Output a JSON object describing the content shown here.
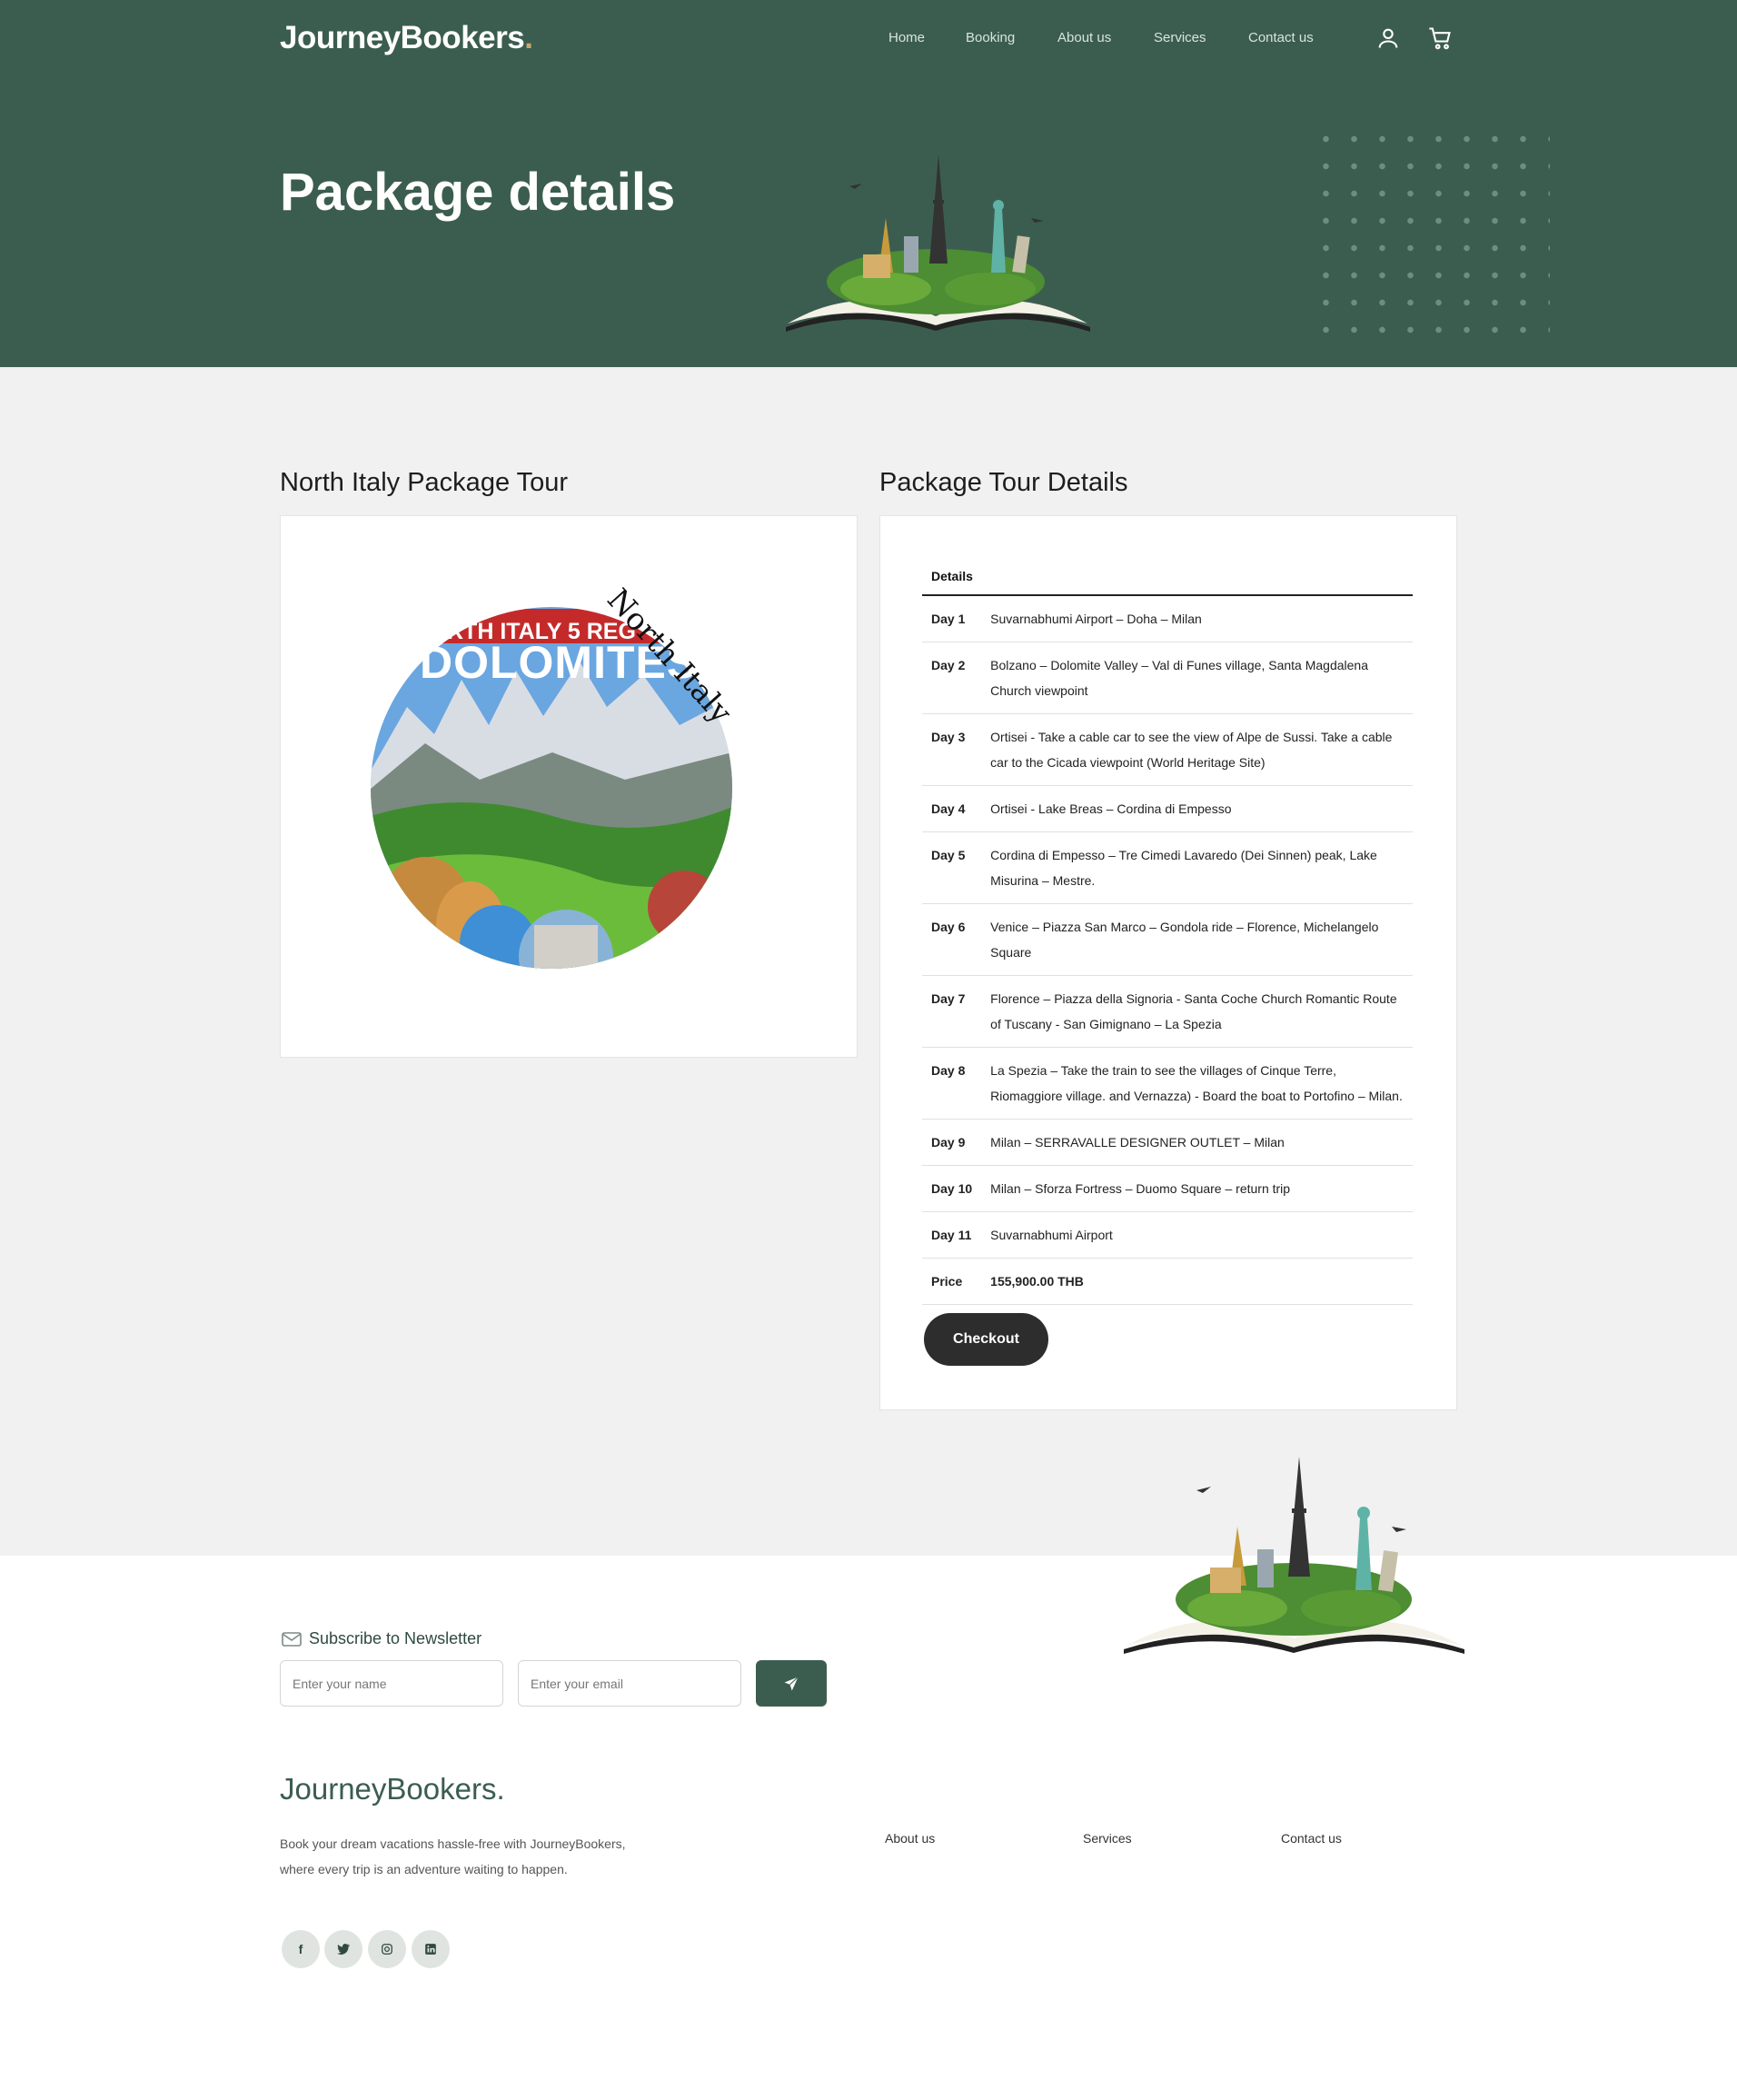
{
  "header": {
    "brand": "JourneyBookers",
    "brand_dot": ".",
    "nav": [
      "Home",
      "Booking",
      "About us",
      "Services",
      "Contact us"
    ],
    "icons": [
      "user-icon",
      "cart-icon"
    ]
  },
  "hero": {
    "title": "Package details"
  },
  "left": {
    "title": "North Italy Package Tour",
    "image_banner": "RTH ITALY 5 REG",
    "image_headline": "DOLOMITES",
    "image_script": "North Italy"
  },
  "right": {
    "title": "Package Tour Details",
    "table_header": "Details",
    "rows": [
      {
        "day": "Day 1",
        "text": "Suvarnabhumi Airport – Doha – Milan"
      },
      {
        "day": "Day 2",
        "text": "Bolzano – Dolomite Valley – Val di Funes village, Santa Magdalena Church viewpoint"
      },
      {
        "day": "Day 3",
        "text": "Ortisei - Take a cable car to see the view of Alpe de Sussi. Take a cable car to the Cicada viewpoint (World Heritage Site)"
      },
      {
        "day": "Day 4",
        "text": "Ortisei - Lake Breas – Cordina di Empesso"
      },
      {
        "day": "Day 5",
        "text": "Cordina di Empesso – Tre Cimedi Lavaredo (Dei Sinnen) peak, Lake Misurina – Mestre."
      },
      {
        "day": "Day 6",
        "text": "Venice – Piazza San Marco – Gondola ride – Florence, Michelangelo Square"
      },
      {
        "day": "Day 7",
        "text": "Florence – Piazza della Signoria - Santa Coche Church Romantic Route of Tuscany - San Gimignano – La Spezia"
      },
      {
        "day": "Day 8",
        "text": "La Spezia – Take the train to see the villages of Cinque Terre, Riomaggiore village. and Vernazza) - Board the boat to Portofino – Milan."
      },
      {
        "day": "Day 9",
        "text": "Milan – SERRAVALLE DESIGNER OUTLET – Milan"
      },
      {
        "day": "Day 10",
        "text": "Milan – Sforza Fortress – Duomo Square – return trip"
      },
      {
        "day": "Day 11",
        "text": "Suvarnabhumi Airport"
      }
    ],
    "price_label": "Price",
    "price_value": "155,900.00 THB",
    "checkout_label": "Checkout"
  },
  "newsletter": {
    "title": "Subscribe to Newsletter",
    "name_placeholder": "Enter your name",
    "email_placeholder": "Enter your email"
  },
  "footer": {
    "brand": "JourneyBookers.",
    "description": "Book your dream vacations hassle-free with JourneyBookers, where every trip is an adventure waiting to happen.",
    "links": [
      "About us",
      "Services",
      "Contact us"
    ],
    "social": [
      "facebook-icon",
      "twitter-icon",
      "instagram-icon",
      "linkedin-icon"
    ]
  },
  "colors": {
    "brand_green": "#3b5d4f",
    "page_grey": "#f0f1f0",
    "button_dark": "#2d2d2d"
  }
}
